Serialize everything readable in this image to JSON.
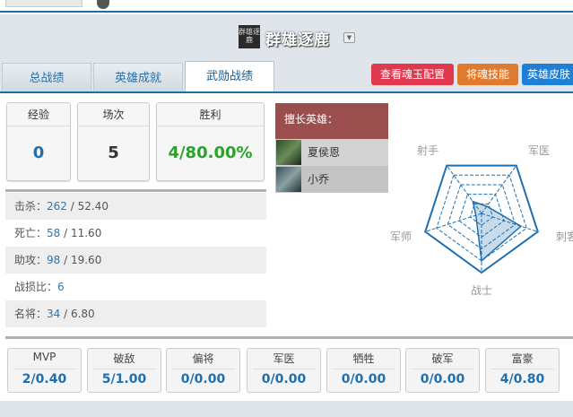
{
  "header": {
    "logo_text": "群雄逐鹿",
    "title": "群雄逐鹿"
  },
  "tabs": [
    {
      "label": "总战绩",
      "active": false
    },
    {
      "label": "英雄成就",
      "active": false
    },
    {
      "label": "武勋战绩",
      "active": true
    }
  ],
  "actions": [
    {
      "label": "查看魂玉配置",
      "color": "#e0384f"
    },
    {
      "label": "将魂技能",
      "color": "#e07a2e"
    },
    {
      "label": "英雄皮肤",
      "color": "#1e7fd6"
    }
  ],
  "stats": [
    {
      "label": "经验",
      "value": "0",
      "color": "#1e6fb0"
    },
    {
      "label": "场次",
      "value": "5",
      "color": "#333333"
    },
    {
      "label": "胜利",
      "value": "4/80.00%",
      "color": "#2aa32a"
    }
  ],
  "details": [
    {
      "label": "击杀：",
      "value": "262",
      "avg": " / 52.40"
    },
    {
      "label": "死亡：",
      "value": "58",
      "avg": " / 11.60"
    },
    {
      "label": "助攻：",
      "value": "98",
      "avg": " / 19.60"
    },
    {
      "label": "战损比：",
      "value": "6",
      "avg": ""
    },
    {
      "label": "名将：",
      "value": "34",
      "avg": " / 6.80"
    }
  ],
  "heroes": {
    "header": "擅长英雄：",
    "items": [
      {
        "name": "夏侯恩"
      },
      {
        "name": "小乔"
      }
    ]
  },
  "radar": {
    "labels": [
      "射手",
      "军医",
      "刺客",
      "战士",
      "军师"
    ],
    "values": [
      0.25,
      0.15,
      0.7,
      0.8,
      0.1
    ],
    "color": "#1e6fb0"
  },
  "bottom_stats": [
    {
      "label": "MVP",
      "value": "2/0.40"
    },
    {
      "label": "破敌",
      "value": "5/1.00"
    },
    {
      "label": "偏将",
      "value": "0/0.00"
    },
    {
      "label": "军医",
      "value": "0/0.00"
    },
    {
      "label": "牺牲",
      "value": "0/0.00"
    },
    {
      "label": "破军",
      "value": "0/0.00"
    },
    {
      "label": "富豪",
      "value": "4/0.80"
    }
  ]
}
